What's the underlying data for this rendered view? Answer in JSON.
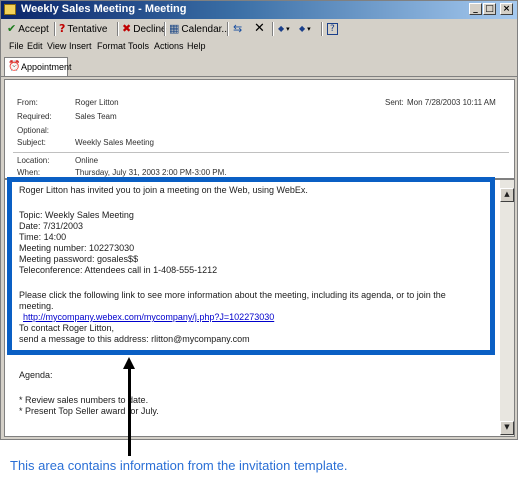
{
  "window": {
    "title": "Weekly Sales Meeting - Meeting"
  },
  "title_buttons": {
    "minimize": "_",
    "maximize": "□",
    "close": "×"
  },
  "toolbar": {
    "accept": "Accept",
    "tentative": "Tentative",
    "decline": "Decline",
    "calendar": "Calendar...",
    "icons": {
      "accept": "✔",
      "tentative": "?",
      "decline": "✖",
      "calendar": "▦",
      "reply": "⇆",
      "delete": "✕",
      "prev": "◆",
      "next": "◆",
      "help": "?"
    }
  },
  "menu": [
    "File",
    "Edit",
    "View",
    "Insert",
    "Format",
    "Tools",
    "Actions",
    "Help"
  ],
  "tab": {
    "label": "Appointment"
  },
  "header": {
    "from_label": "From:",
    "from_value": "Roger Litton",
    "required_label": "Required:",
    "required_value": "Sales Team",
    "optional_label": "Optional:",
    "subject_label": "Subject:",
    "subject_value": "Weekly Sales Meeting",
    "sent_label": "Sent:",
    "sent_value": "Mon 7/28/2003 10:11 AM",
    "location_label": "Location:",
    "location_value": "Online",
    "when_label": "When:",
    "when_value": "Thursday, July 31, 2003 2:00 PM-3:00 PM."
  },
  "body": {
    "intro": "Roger Litton has invited you to join a meeting on the Web, using WebEx.",
    "topic": "Topic: Weekly Sales Meeting",
    "date": "Date: 7/31/2003",
    "time": "Time: 14:00",
    "meeting_number": "Meeting number: 102273030",
    "meeting_password": "Meeting password: gosales$$",
    "teleconference": "Teleconference: Attendees call in 1-408-555-1212",
    "info_line1": "Please click the following link to see more information about the meeting, including its agenda, or to join the",
    "info_line2": "meeting.",
    "link": "http://mycompany.webex.com/mycompany/j.php?J=102273030",
    "contact": "To contact Roger Litton,",
    "send": "send a message to this address: rlitton@mycompany.com",
    "agenda": "Agenda:",
    "agenda_item1": "* Review sales numbers to date.",
    "agenda_item2": "* Present Top Seller award for July."
  },
  "scroll": {
    "up": "▲",
    "down": "▼"
  },
  "caption": "This area contains information from the invitation template.",
  "colors": {
    "highlight": "#0a5fc4",
    "caption": "#2a6fd6",
    "titlebar": "#0a246a"
  }
}
